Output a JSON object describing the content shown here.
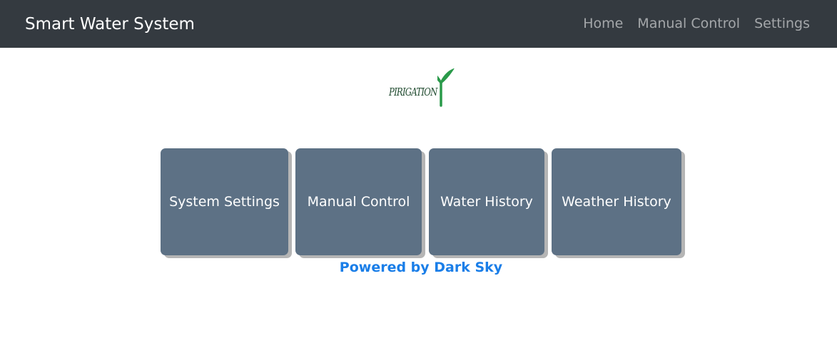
{
  "navbar": {
    "brand": "Smart Water System",
    "links": [
      {
        "label": "Home"
      },
      {
        "label": "Manual Control"
      },
      {
        "label": "Settings"
      }
    ]
  },
  "logo": {
    "text": "PIRIGATION",
    "icon": "sprout-icon",
    "color": "#2a9a4a"
  },
  "tiles": [
    {
      "label": "System Settings"
    },
    {
      "label": "Manual Control"
    },
    {
      "label": "Water History"
    },
    {
      "label": "Weather History"
    }
  ],
  "footer": {
    "powered_by": "Powered by Dark Sky"
  },
  "colors": {
    "navbar_bg": "#343a40",
    "tile_bg": "#5d7185",
    "link": "#1a7ee8"
  }
}
